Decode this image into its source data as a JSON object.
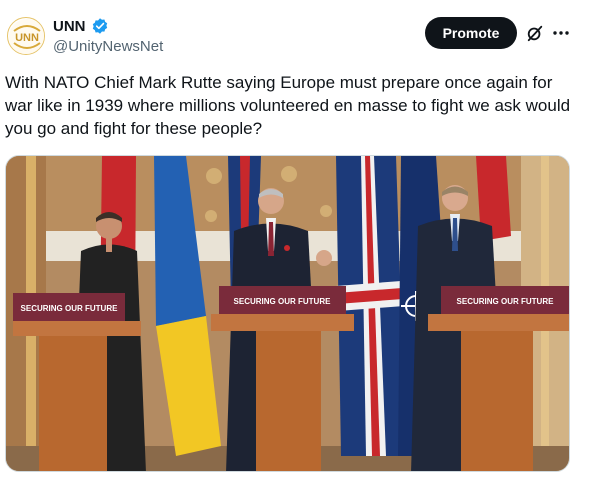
{
  "account": {
    "display_name": "UNN",
    "handle": "@UnityNewsNet",
    "avatar_logo_text": "UNN",
    "verified_color": "#1d9bf0"
  },
  "actions": {
    "promote_label": "Promote",
    "grok_icon": "grok-icon",
    "more_icon": "more-icon"
  },
  "post": {
    "text": "With NATO Chief Mark Rutte saying Europe must prepare once again for war like in 1939 where millions volunteered en masse to fight we ask would you go and fight for these people?"
  },
  "media": {
    "podium_left_label": "SECURING OUR FUTURE",
    "podium_center_label": "SECURING OUR FUTURE",
    "podium_right_label": "SECURING OUR FUTURE"
  },
  "colors": {
    "text_primary": "#0f1419",
    "text_secondary": "#536471",
    "button_dark": "#0f1419",
    "podium_banner": "#7a2b3b"
  }
}
